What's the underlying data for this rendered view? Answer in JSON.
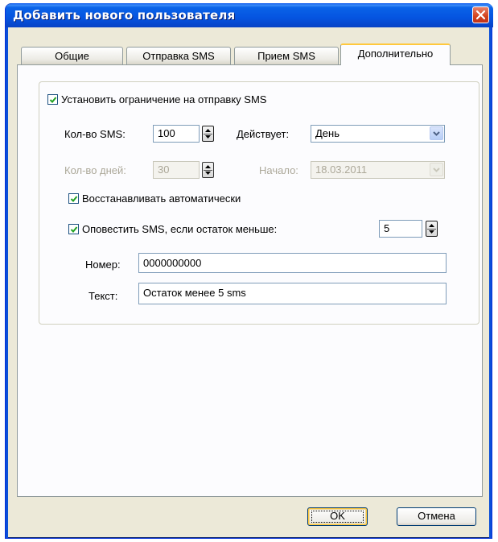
{
  "window": {
    "title": "Добавить нового пользователя"
  },
  "tabs": [
    {
      "label": "Общие"
    },
    {
      "label": "Отправка SMS"
    },
    {
      "label": "Прием SMS"
    },
    {
      "label": "Дополнительно"
    }
  ],
  "limit": {
    "checkbox_label": "Установить ограничение на отправку SMS",
    "checked": true,
    "sms_count_label": "Кол-во SMS:",
    "sms_count_value": "100",
    "period_label": "Действует:",
    "period_value": "День",
    "days_label": "Кол-во дней:",
    "days_value": "30",
    "start_label": "Начало:",
    "start_value": "18.03.2011"
  },
  "restore": {
    "label": "Восстанавливать автоматически",
    "checked": true
  },
  "notify": {
    "label": "Оповестить SMS, если остаток меньше:",
    "checked": true,
    "threshold_value": "5",
    "number_label": "Номер:",
    "number_value": "0000000000",
    "text_label": "Текст:",
    "text_value": "Остаток менее 5 sms"
  },
  "buttons": {
    "ok": "OK",
    "cancel": "Отмена"
  },
  "colors": {
    "title_bar": "#0554e0",
    "close_button": "#d2421c",
    "active_tab_accent": "#ffc83c",
    "checkmark": "#21a121"
  },
  "icons": {
    "close": "close-icon",
    "spin": "spin-arrows-icon",
    "dropdown": "chevron-down-icon",
    "check": "check-icon"
  }
}
